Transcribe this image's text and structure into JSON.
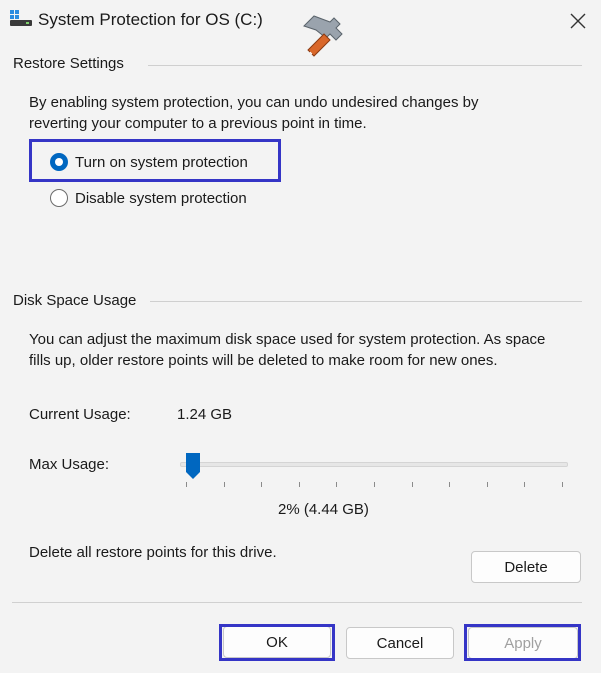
{
  "window": {
    "title": "System Protection for OS (C:)"
  },
  "restore_settings": {
    "group_label": "Restore Settings",
    "description_line1": "By enabling system protection, you can undo undesired changes by",
    "description_line2": "reverting your computer to a previous point in time.",
    "options": [
      {
        "label": "Turn on system protection",
        "checked": true
      },
      {
        "label": "Disable system protection",
        "checked": false
      }
    ]
  },
  "disk_space": {
    "group_label": "Disk Space Usage",
    "description_line1": "You can adjust the maximum disk space used for system protection. As space",
    "description_line2": "fills up, older restore points will be deleted to make room for new ones.",
    "current_usage_label": "Current Usage:",
    "current_usage_value": "1.24 GB",
    "max_usage_label": "Max Usage:",
    "max_usage_fraction": 0.02,
    "max_usage_value": "2% (4.44 GB)",
    "delete_text": "Delete all restore points for this drive.",
    "delete_button": "Delete"
  },
  "footer": {
    "ok_label": "OK",
    "cancel_label": "Cancel",
    "apply_label": "Apply",
    "apply_disabled": true
  },
  "colors": {
    "accent": "#0067c0",
    "highlight_border": "#3535c6"
  }
}
